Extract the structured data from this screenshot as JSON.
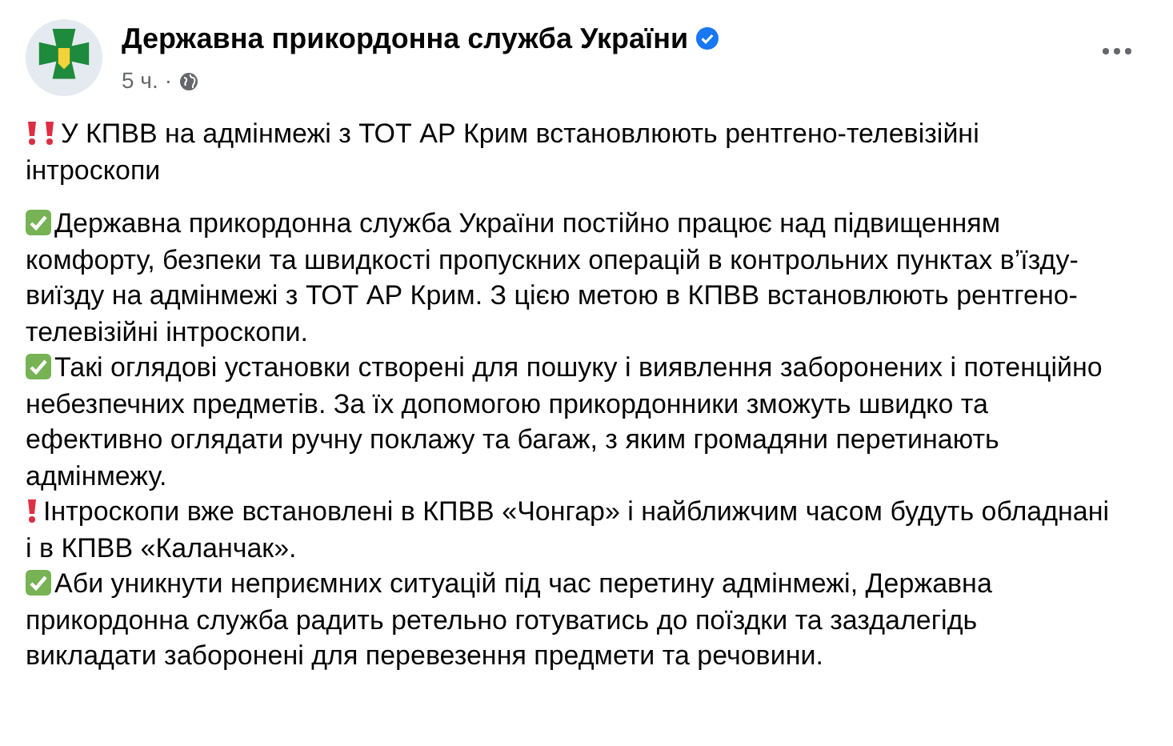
{
  "post": {
    "author": "Державна прикордонна служба України",
    "verified": true,
    "time": "5 ч.",
    "dot": "·",
    "headline": {
      "icons": [
        {
          "kind": "exclamation"
        },
        {
          "kind": "exclamation"
        }
      ],
      "text": "У КПВВ на адмінмежі з ТОТ АР Крим встановлюють рентгено-телевізійні інтроскопи"
    },
    "paragraphs": [
      {
        "kind": "check",
        "text": "Державна прикордонна служба України постійно працює над підвищенням комфорту, безпеки та швидкості пропускних операцій в контрольних пунктах в’їзду-виїзду на адмінмежі з ТОТ АР Крим. З цією метою в КПВВ встановлюють рентгено-телевізійні інтроскопи."
      },
      {
        "kind": "check",
        "text": "Такі оглядові установки створені для пошуку і виявлення заборонених і потенційно небезпечних предметів. За їх допомогою прикордонники зможуть швидко та ефективно оглядати ручну поклажу та багаж, з яким громадяни перетинають адмінмежу."
      },
      {
        "kind": "exclamation",
        "text": "Інтроскопи вже встановлені в КПВВ «Чонгар» і найближчим часом будуть обладнані і в КПВВ «Каланчак»."
      },
      {
        "kind": "check",
        "text": "Аби уникнути неприємних ситуацій під час перетину адмінмежі, Державна прикордонна служба радить ретельно готуватись до поїздки та заздалегідь викладати заборонені для перевезення предмети та речовини."
      }
    ]
  }
}
